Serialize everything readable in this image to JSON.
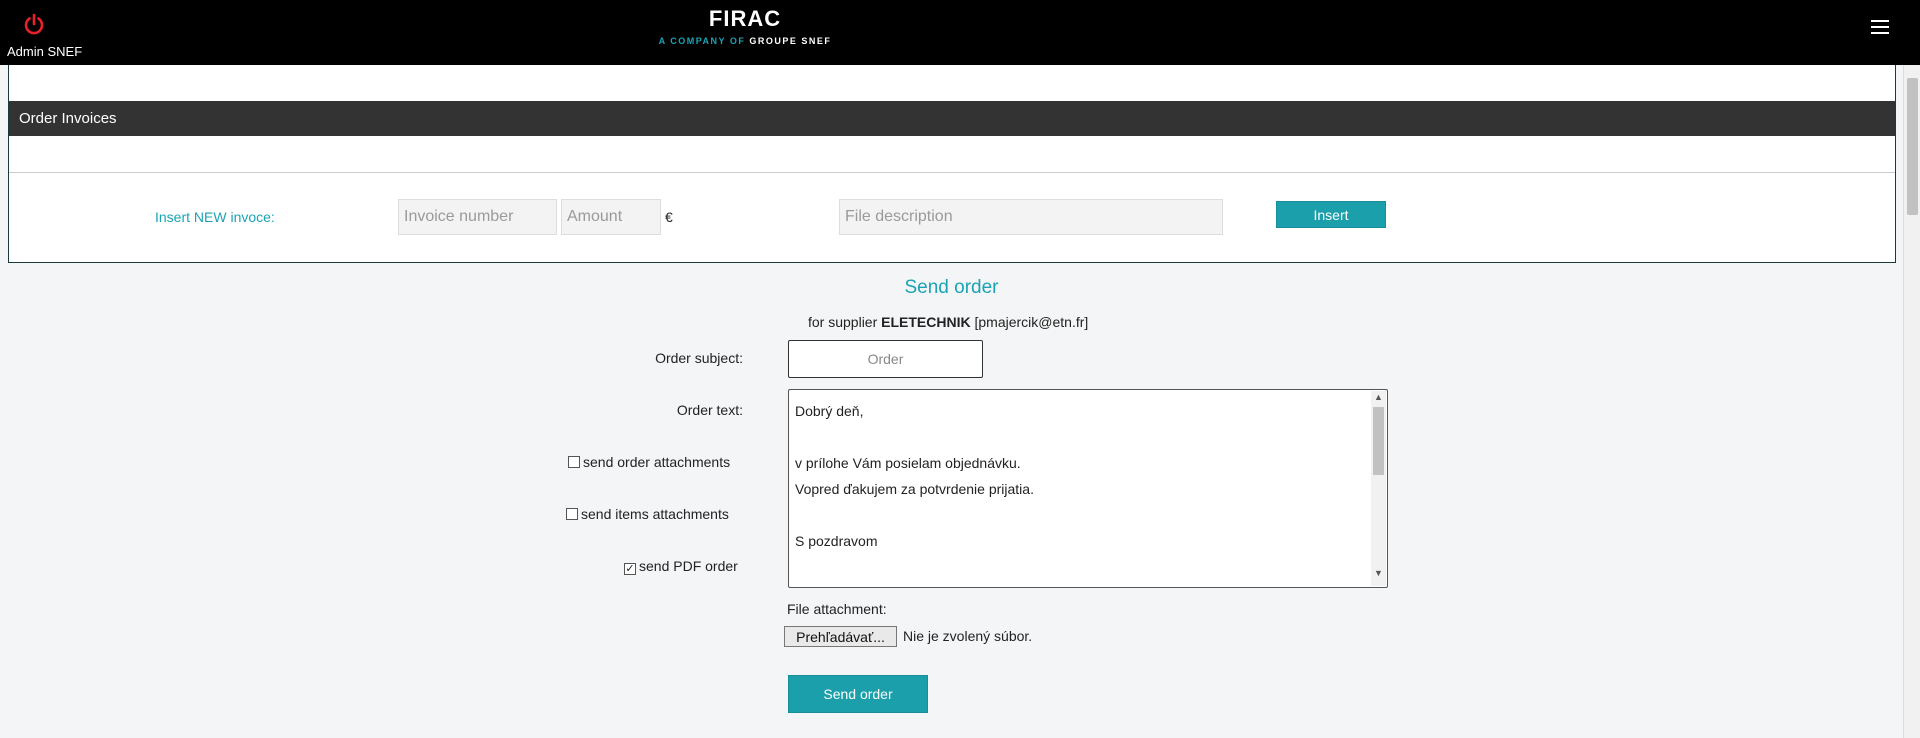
{
  "header": {
    "user_name": "Admin SNEF",
    "logo_main": "FIRAC",
    "logo_tagline_part1": "A COMPANY OF",
    "logo_tagline_part2": "GROUPE SNEF",
    "power_icon": "power-icon",
    "menu_icon": "hamburger-menu-icon"
  },
  "invoices": {
    "section_title": "Order Invoices",
    "insert_label": "Insert NEW invoce:",
    "invoice_number_placeholder": "Invoice number",
    "amount_placeholder": "Amount",
    "currency": "€",
    "file_description_placeholder": "File description",
    "insert_button": "Insert"
  },
  "send_order": {
    "title": "Send order",
    "supplier_prefix": "for supplier",
    "supplier_name": "ELETECHNIK",
    "supplier_email": "[pmajercik@etn.fr]",
    "subject_label": "Order subject:",
    "subject_placeholder": "Order",
    "text_label": "Order text:",
    "order_text": "Dobrý deň,\n\nv prílohe Vám posielam objednávku.\nVopred ďakujem za potvrdenie prijatia.\n\nS pozdravom",
    "send_order_attachments_label": "send order attachments",
    "send_order_attachments_checked": false,
    "send_items_attachments_label": "send items attachments",
    "send_items_attachments_checked": false,
    "send_pdf_order_label": "send PDF order",
    "send_pdf_order_checked": true,
    "file_attachment_label": "File attachment:",
    "browse_button": "Prehľadávať...",
    "no_file_text": "Nie je zvolený súbor.",
    "send_button": "Send order"
  },
  "colors": {
    "accent": "#1a9fab",
    "header_bg": "#000000",
    "section_header_bg": "#333333",
    "power_icon": "#e8202a"
  }
}
